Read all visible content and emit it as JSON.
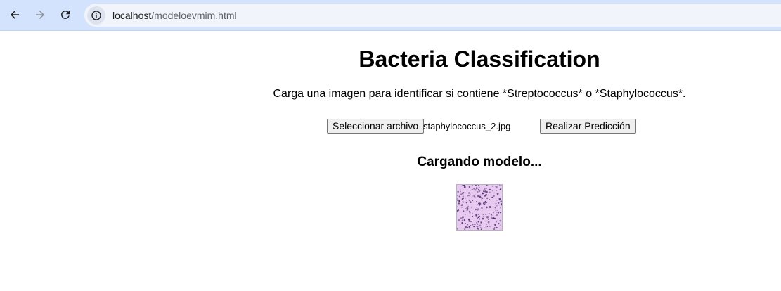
{
  "browser": {
    "url_host": "localhost",
    "url_path": "/modeloevmim.html"
  },
  "page": {
    "title": "Bacteria Classification",
    "subtitle": "Carga una imagen para identificar si contiene *Streptococcus* o *Staphylococcus*.",
    "file_button_label": "Seleccionar archivo",
    "file_name": "staphylococcus_2.jpg",
    "predict_button_label": "Realizar Predicción",
    "status_text": "Cargando modelo..."
  },
  "colors": {
    "toolbar_bg": "#d3e3fd",
    "omnibox_bg": "#f1f4fb",
    "preview_bg": "#e8c9ef",
    "preview_cells": "#4a2b6e"
  },
  "icons": {
    "back": "arrow-left-icon",
    "forward": "arrow-right-icon",
    "reload": "reload-icon",
    "site_info": "info-icon"
  }
}
